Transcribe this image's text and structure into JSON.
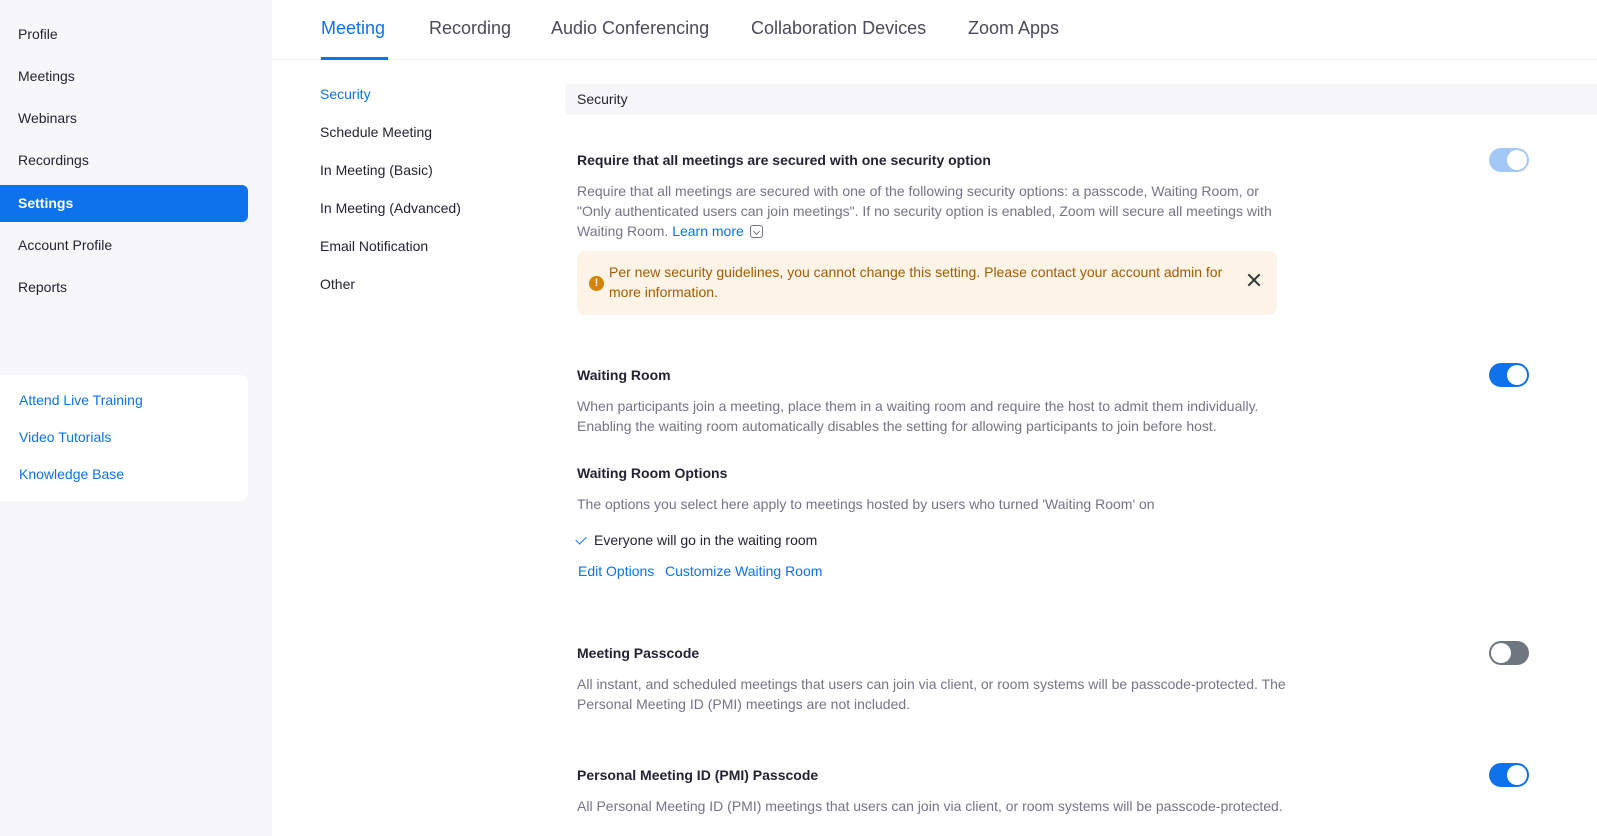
{
  "sidebar": {
    "items": [
      {
        "label": "Profile"
      },
      {
        "label": "Meetings"
      },
      {
        "label": "Webinars"
      },
      {
        "label": "Recordings"
      },
      {
        "label": "Settings",
        "active": true
      },
      {
        "label": "Account Profile"
      },
      {
        "label": "Reports"
      }
    ],
    "help_links": [
      {
        "label": "Attend Live Training"
      },
      {
        "label": "Video Tutorials"
      },
      {
        "label": "Knowledge Base"
      }
    ]
  },
  "tabs": [
    {
      "label": "Meeting",
      "active": true
    },
    {
      "label": "Recording"
    },
    {
      "label": "Audio Conferencing"
    },
    {
      "label": "Collaboration Devices"
    },
    {
      "label": "Zoom Apps"
    }
  ],
  "subnav": [
    {
      "label": "Security",
      "active": true
    },
    {
      "label": "Schedule Meeting"
    },
    {
      "label": "In Meeting (Basic)"
    },
    {
      "label": "In Meeting (Advanced)"
    },
    {
      "label": "Email Notification"
    },
    {
      "label": "Other"
    }
  ],
  "section": {
    "title": "Security"
  },
  "settings": {
    "require_secure": {
      "title": "Require that all meetings are secured with one security option",
      "description": "Require that all meetings are secured with one of the following security options: a passcode, Waiting Room, or \"Only authenticated users can join meetings\". If no security option is enabled, Zoom will secure all meetings with Waiting Room.",
      "learn_more": "Learn more",
      "toggle_state": "on-disabled",
      "warning": "Per new security guidelines, you cannot change this setting. Please contact your account admin for more information.",
      "warning_icon": "!"
    },
    "waiting_room": {
      "title": "Waiting Room",
      "description": "When participants join a meeting, place them in a waiting room and require the host to admit them individually. Enabling the waiting room automatically disables the setting for allowing participants to join before host.",
      "toggle_state": "on",
      "options_title": "Waiting Room Options",
      "options_description": "The options you select here apply to meetings hosted by users who turned 'Waiting Room' on",
      "selected_option": "Everyone will go in the waiting room",
      "edit_options": "Edit Options",
      "customize": "Customize Waiting Room"
    },
    "meeting_passcode": {
      "title": "Meeting Passcode",
      "description": "All instant, and scheduled meetings that users can join via client, or room systems will be passcode-protected. The Personal Meeting ID (PMI) meetings are not included.",
      "toggle_state": "off"
    },
    "pmi_passcode": {
      "title": "Personal Meeting ID (PMI) Passcode",
      "description": "All Personal Meeting ID (PMI) meetings that users can join via client, or room systems will be passcode-protected.",
      "toggle_state": "on"
    }
  },
  "colors": {
    "accent": "#0e72ed",
    "warning_bg": "#fdf3e7",
    "warning_text": "#a35c00"
  }
}
